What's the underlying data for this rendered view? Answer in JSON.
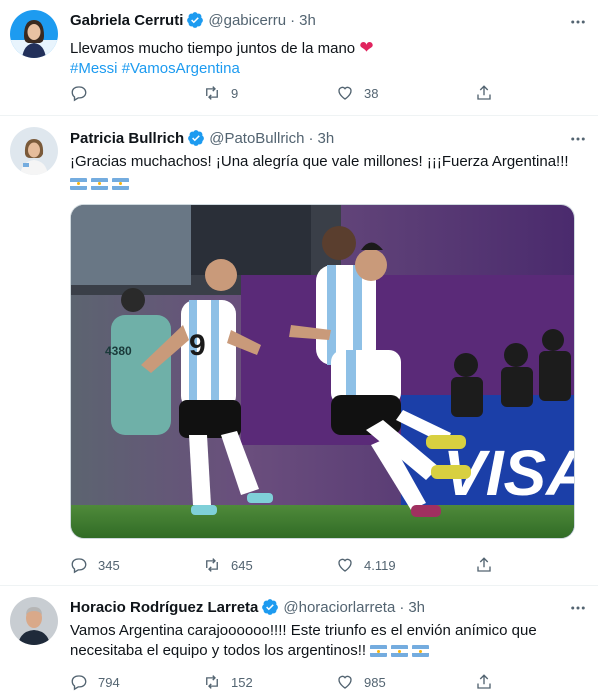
{
  "tweets": [
    {
      "name": "Gabriela Cerruti",
      "handle": "@gabicerru",
      "time": "3h",
      "text": "Llevamos mucho tiempo juntos de la mano",
      "emoji": "❤",
      "hashtags": [
        "#Messi",
        "#VamosArgentina"
      ],
      "replies": "",
      "retweets": "9",
      "likes": "38"
    },
    {
      "name": "Patricia Bullrich",
      "handle": "@PatoBullrich",
      "time": "3h",
      "text": "¡Gracias muchachos! ¡Una alegría que vale millones! ¡¡¡Fuerza Argentina!!!",
      "flag_count": 3,
      "replies": "345",
      "retweets": "645",
      "likes": "4.119",
      "photo": {
        "jersey_number": "9",
        "board_number": "4380",
        "sponsor_text": "VISA"
      }
    },
    {
      "name": "Horacio Rodríguez Larreta",
      "handle": "@horaciorlarreta",
      "time": "3h",
      "text_line1": "Vamos Argentina carajoooooo!!!! Este triunfo es el envión anímico que",
      "text_line2": "necesitaba el equipo y todos los argentinos!!",
      "flag_count": 3,
      "replies": "794",
      "retweets": "152",
      "likes": "985"
    }
  ],
  "colors": {
    "accent": "#1d9bf0",
    "secondary_text": "#536471",
    "heart": "#e0245e",
    "argentina_blue": "#74acdf"
  },
  "icons": [
    "verified-badge-icon",
    "more-icon",
    "reply-icon",
    "retweet-icon",
    "like-icon",
    "share-icon"
  ]
}
